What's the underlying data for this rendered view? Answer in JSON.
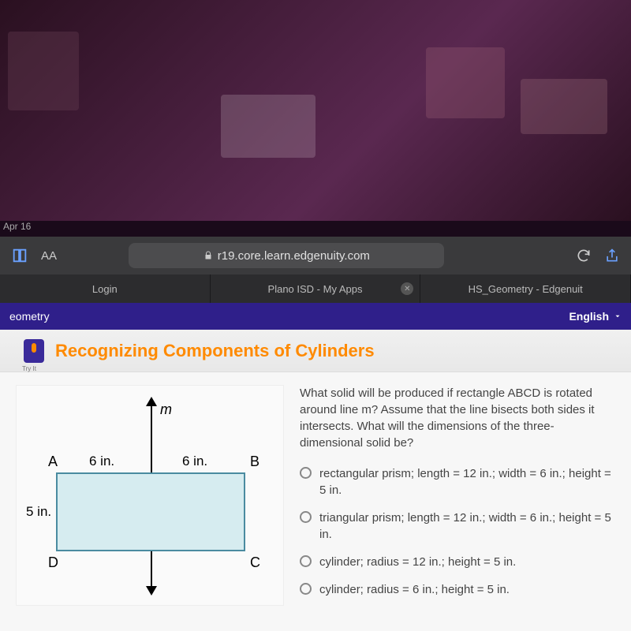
{
  "date": "Apr 16",
  "browser": {
    "aa": "AA",
    "url": "r19.core.learn.edgenuity.com"
  },
  "tabs": [
    {
      "label": "Login"
    },
    {
      "label": "Plano ISD - My Apps"
    },
    {
      "label": "HS_Geometry - Edgenuit"
    }
  ],
  "app": {
    "course": "eometry",
    "language": "English"
  },
  "lesson": {
    "tryit": "Try It",
    "title": "Recognizing Components of Cylinders"
  },
  "figure": {
    "m": "m",
    "A": "A",
    "B": "B",
    "C": "C",
    "D": "D",
    "dim6a": "6 in.",
    "dim6b": "6 in.",
    "dim5": "5 in."
  },
  "question": "What solid will be produced if rectangle ABCD is rotated around line m? Assume that the line bisects both sides it intersects. What will the dimensions of the three-dimensional solid be?",
  "options": [
    "rectangular prism; length = 12 in.; width = 6 in.; height = 5 in.",
    "triangular prism; length = 12 in.; width = 6 in.; height = 5 in.",
    "cylinder; radius = 12 in.; height = 5 in.",
    "cylinder; radius = 6 in.; height = 5 in."
  ]
}
